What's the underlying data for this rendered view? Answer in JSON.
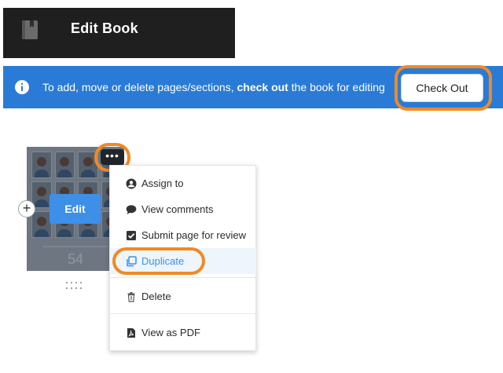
{
  "header": {
    "title": "Edit Book",
    "book_icon": "book-icon"
  },
  "banner": {
    "icon": "info-icon",
    "text_before": "To add, move or delete pages/sections, ",
    "text_bold": "check out",
    "text_after": " the book for editing",
    "button_label": "Check Out"
  },
  "thumbnail": {
    "page_number": "54",
    "edit_label": "Edit",
    "add_label": "+",
    "more_label": "•••"
  },
  "menu": {
    "items": [
      {
        "label": "Assign to",
        "icon": "user-icon"
      },
      {
        "label": "View comments",
        "icon": "comment-icon"
      },
      {
        "label": "Submit page for review",
        "icon": "checkbox-icon"
      },
      {
        "label": "Duplicate",
        "icon": "duplicate-icon",
        "active": true
      },
      {
        "label": "Delete",
        "icon": "trash-icon"
      },
      {
        "label": "View as PDF",
        "icon": "pdf-icon"
      }
    ]
  },
  "colors": {
    "header_bg": "#1f1f1f",
    "banner_bg": "#2a7bd6",
    "accent": "#3d8fe8",
    "highlight": "#f08a24",
    "active_item_bg": "#eef5fc"
  }
}
